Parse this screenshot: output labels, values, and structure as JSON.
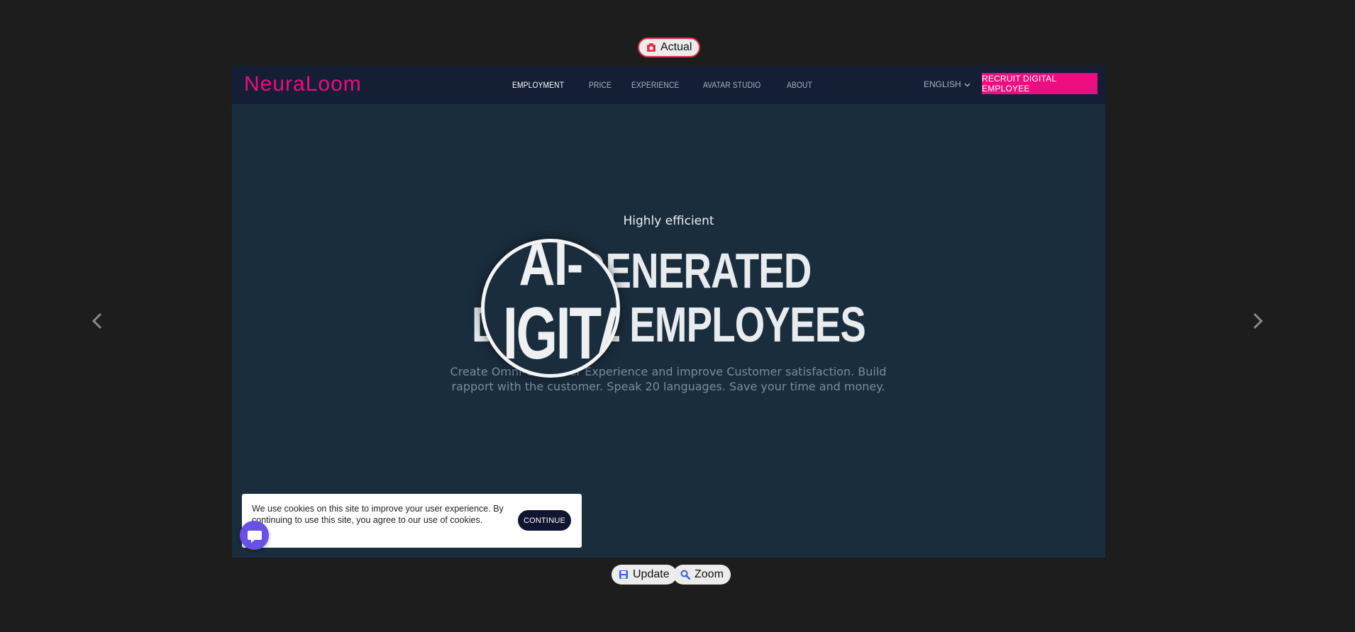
{
  "viewer": {
    "actual_label": "Actual",
    "update_label": "Update",
    "zoom_label": "Zoom"
  },
  "site": {
    "logo": "NeuraLoom",
    "menu": [
      {
        "label": "EMPLOYMENT",
        "active": true
      },
      {
        "label": "PRICE",
        "active": false
      },
      {
        "label": "EXPERIENCE",
        "active": false
      },
      {
        "label": "AVATAR STUDIO",
        "active": false
      },
      {
        "label": "ABOUT",
        "active": false
      }
    ],
    "language": "ENGLISH",
    "cta": "RECRUIT DIGITAL EMPLOYEE"
  },
  "hero": {
    "eyebrow": "Highly efficient",
    "headline_line1": "AI-GENERATED",
    "headline_line2": "DIGITAL EMPLOYEES",
    "description": "Create Omni-Customer Experience and improve Customer satisfaction. Build rapport with the customer. Speak 20 languages. Save your time and money.",
    "magnifier_line1": "AI-",
    "magnifier_line2": "IGITA"
  },
  "cookie_banner": {
    "text": "We use cookies on this site to improve your user experience. By continuing to use this site, you agree to our use of cookies.",
    "button": "CONTINUE"
  },
  "colors": {
    "brand_pink": "#ec0d80",
    "nav_bg": "#141f35",
    "hero_bg": "#1a2d3d",
    "chat_purple": "#6a4fe8"
  },
  "icons": [
    "camera-icon",
    "save-icon",
    "search-icon",
    "chevron-left-icon",
    "chevron-right-icon",
    "chevron-down-icon",
    "chat-icon"
  ]
}
